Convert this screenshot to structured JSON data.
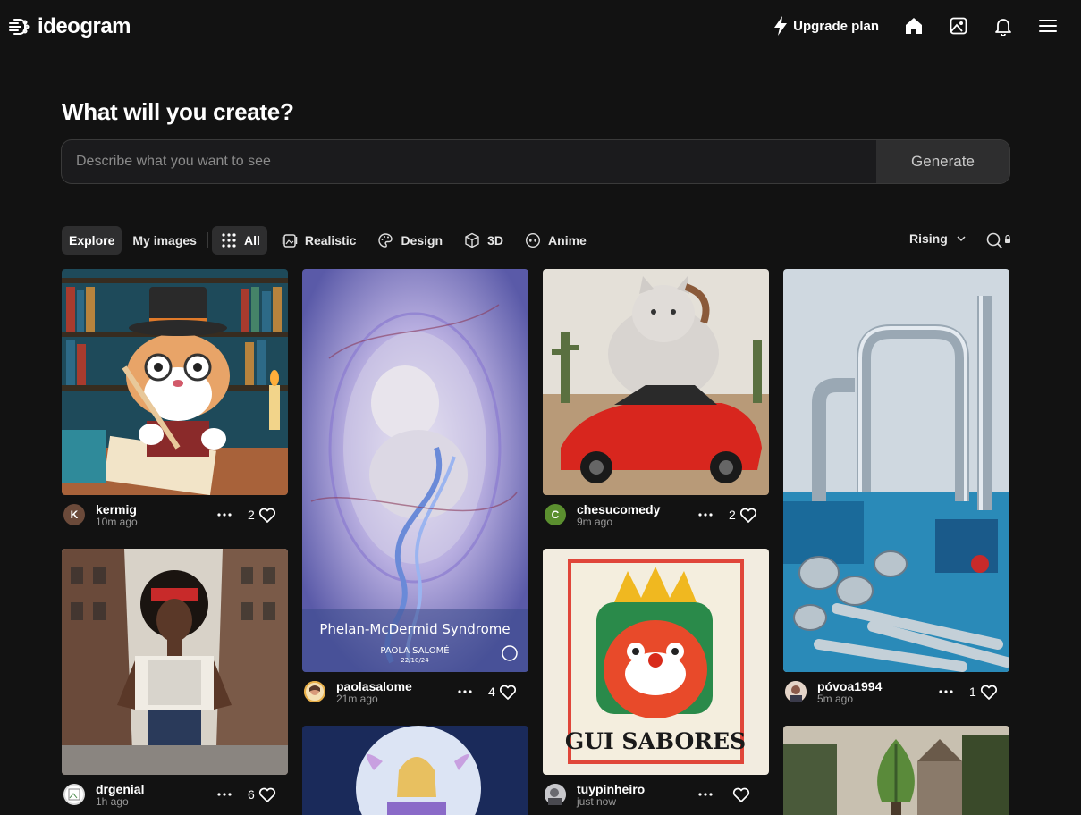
{
  "app": {
    "brand": "ideogram",
    "upgrade_label": "Upgrade plan",
    "icons": [
      "logo-icon",
      "bolt-icon",
      "home-icon",
      "gallery-icon",
      "bell-icon",
      "menu-icon"
    ]
  },
  "hero": {
    "title": "What will you create?",
    "prompt_placeholder": "Describe what you want to see",
    "generate_label": "Generate"
  },
  "filters": {
    "explore": "Explore",
    "my_images": "My images",
    "categories": [
      {
        "label": "All",
        "icon": "grid-icon",
        "active": true
      },
      {
        "label": "Realistic",
        "icon": "cards-icon"
      },
      {
        "label": "Design",
        "icon": "palette-icon"
      },
      {
        "label": "3D",
        "icon": "cube-icon"
      },
      {
        "label": "Anime",
        "icon": "face-icon"
      }
    ],
    "sort": "Rising"
  },
  "cards": [
    {
      "user": "kermig",
      "time": "10m ago",
      "likes": "2",
      "avatar_letter": "K",
      "avatar_color": "#6b4a3a"
    },
    {
      "user": "drgenial",
      "time": "1h ago",
      "likes": "6",
      "avatar_letter": "",
      "avatar_color": "#ffffff"
    },
    {
      "user": "paolasalome",
      "time": "21m ago",
      "likes": "4",
      "avatar_letter": "",
      "avatar_color": "#e8b04a",
      "image_title": "Phelan-McDermid Syndrome",
      "image_author": "PAOLA SALOMÉ",
      "image_date": "22/10/24"
    },
    {
      "user": "chesucomedy",
      "time": "9m ago",
      "likes": "2",
      "avatar_letter": "C",
      "avatar_color": "#5b8f2f"
    },
    {
      "user": "tuypinheiro",
      "time": "just now",
      "likes": "",
      "avatar_letter": "",
      "avatar_color": "#8a8a8a",
      "image_title": "GUI SABORES"
    },
    {
      "user": "póvoa1994",
      "time": "5m ago",
      "likes": "1",
      "avatar_letter": "",
      "avatar_color": "#b89a8a"
    }
  ]
}
